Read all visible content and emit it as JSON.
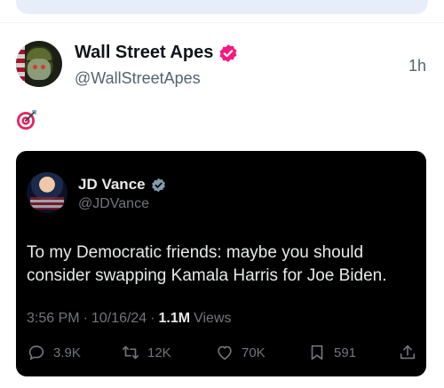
{
  "post": {
    "author": {
      "display_name": "Wall Street Apes",
      "handle": "@WallStreetApes"
    },
    "time": "1h",
    "body_emoji": "🎯"
  },
  "quote": {
    "author": {
      "display_name": "JD Vance",
      "handle": "@JDVance"
    },
    "text": "To my Democratic friends: maybe you should consider swapping Kamala Harris for Joe Biden.",
    "meta": {
      "time": "3:56 PM",
      "separator": "·",
      "date": "10/16/24",
      "views_count": "1.1M",
      "views_label": "Views"
    },
    "actions": {
      "replies": "3.9K",
      "reposts": "12K",
      "likes": "70K",
      "bookmarks": "591"
    }
  },
  "colors": {
    "verified_badge": "#f91880",
    "quote_badge": "#829aab",
    "target_red": "#e0245e"
  }
}
